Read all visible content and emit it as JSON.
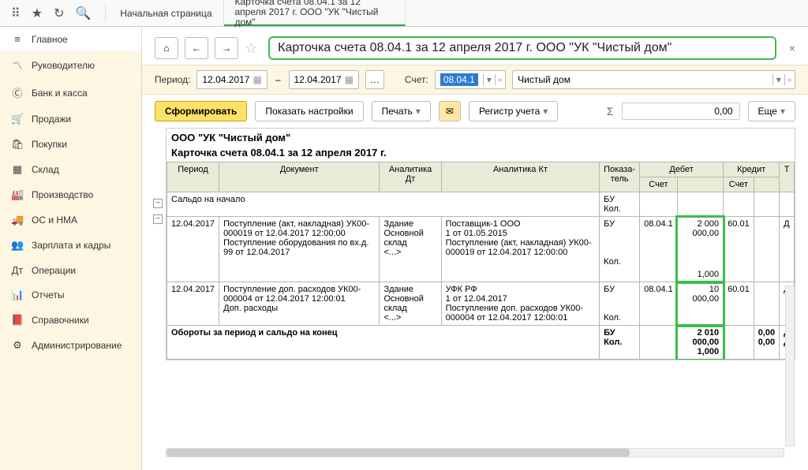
{
  "header": {
    "tabs": [
      "Начальная страница",
      "Карточка счета 08.04.1 за 12 апреля 2017 г. ООО \"УК \"Чистый дом\""
    ]
  },
  "sidebar": {
    "items": [
      {
        "icon": "≡",
        "label": "Главное"
      },
      {
        "icon": "〽",
        "label": "Руководителю"
      },
      {
        "icon": "Ⓒ",
        "label": "Банк и касса"
      },
      {
        "icon": "🛒",
        "label": "Продажи"
      },
      {
        "icon": "🛍",
        "label": "Покупки"
      },
      {
        "icon": "▦",
        "label": "Склад"
      },
      {
        "icon": "🏭",
        "label": "Производство"
      },
      {
        "icon": "🚚",
        "label": "ОС и НМА"
      },
      {
        "icon": "👥",
        "label": "Зарплата и кадры"
      },
      {
        "icon": "Дт",
        "label": "Операции"
      },
      {
        "icon": "📊",
        "label": "Отчеты"
      },
      {
        "icon": "📕",
        "label": "Справочники"
      },
      {
        "icon": "⚙",
        "label": "Администрирование"
      }
    ]
  },
  "page": {
    "title": "Карточка счета 08.04.1 за 12 апреля 2017 г. ООО \"УК \"Чистый дом\"",
    "period_label": "Период:",
    "date_from": "12.04.2017",
    "date_to": "12.04.2017",
    "account_label": "Счет:",
    "account": "08.04.1",
    "account_name": "Чистый дом",
    "generate": "Сформировать",
    "show_settings": "Показать настройки",
    "print": "Печать",
    "register": "Регистр учета",
    "sum_symbol": "Σ",
    "sum_value": "0,00",
    "more": "Еще"
  },
  "report": {
    "org": "ООО \"УК \"Чистый дом\"",
    "title": "Карточка счета 08.04.1 за 12 апреля 2017 г.",
    "columns": [
      "Период",
      "Документ",
      "Аналитика Дт",
      "Аналитика Кт",
      "Показа-\nтель",
      "Дебет",
      "",
      "Кредит",
      "",
      "Т"
    ],
    "subcols": [
      "Счет",
      "",
      "Счет",
      ""
    ],
    "opening": "Сальдо на начало",
    "opening_ind": "БУ\nКол.",
    "rows": [
      {
        "date": "12.04.2017",
        "doc": "Поступление (акт, накладная) УК00-000019 от 12.04.2017 12:00:00\nПоступление оборудования по вх.д. 99 от 12.04.2017",
        "an_dt": "Здание\nОсновной склад\n<...>",
        "an_kt": "Поставщик-1 ООО\n1 от 01.05.2015\nПоступление (акт, накладная) УК00-000019 от 12.04.2017 12:00:00",
        "ind": "БУ\n\n\n\nКол.",
        "dt_acc": "08.04.1",
        "dt_val": "2 000 000,00",
        "dt_qty": "1,000",
        "kt_acc": "60.01",
        "kt_val": "",
        "t": "Д"
      },
      {
        "date": "12.04.2017",
        "doc": "Поступление доп. расходов УК00-000004 от 12.04.2017 12:00:01\nДоп. расходы",
        "an_dt": "Здание\nОсновной склад\n<...>",
        "an_kt": "УФК РФ\n1 от 12.04.2017\nПоступление доп. расходов УК00-000004 от 12.04.2017 12:00:01",
        "ind": "БУ\n\n\nКол.",
        "dt_acc": "08.04.1",
        "dt_val": "10 000,00",
        "dt_qty": "",
        "kt_acc": "60.01",
        "kt_val": "",
        "t": "Д"
      }
    ],
    "totals_label": "Обороты за период и сальдо на конец",
    "totals_ind": "БУ\nКол.",
    "totals_dt": "2 010 000,00",
    "totals_dt_qty": "1,000",
    "totals_kt": "0,00",
    "totals_kt_qty": "0,00",
    "totals_t": "Д\nД"
  }
}
